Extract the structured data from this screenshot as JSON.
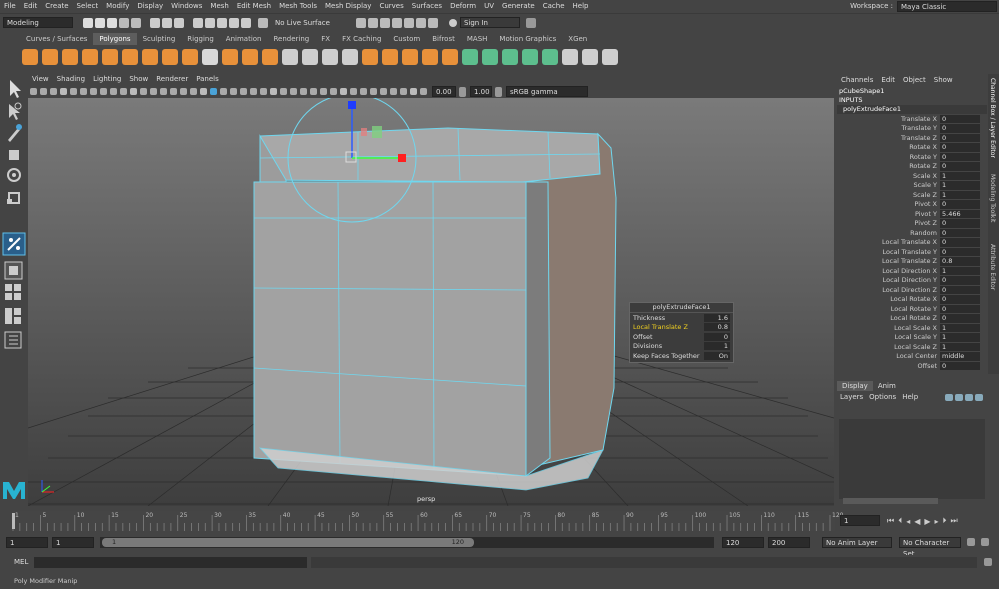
{
  "menubar": {
    "items": [
      "File",
      "Edit",
      "Create",
      "Select",
      "Modify",
      "Display",
      "Windows",
      "Mesh",
      "Edit Mesh",
      "Mesh Tools",
      "Mesh Display",
      "Curves",
      "Surfaces",
      "Deform",
      "UV",
      "Generate",
      "Cache",
      "Help"
    ],
    "workspace_label": "Workspace :",
    "workspace_value": "Maya Classic"
  },
  "statusline": {
    "mode": "Modeling",
    "live_surface": "No Live Surface",
    "sign_in": "Sign In"
  },
  "shelf": {
    "tabs": [
      "Curves / Surfaces",
      "Polygons",
      "Sculpting",
      "Rigging",
      "Animation",
      "Rendering",
      "FX",
      "FX Caching",
      "Custom",
      "Bifrost",
      "MASH",
      "Motion Graphics",
      "XGen"
    ],
    "active_tab": "Polygons",
    "icon_colors": [
      "#e8913a",
      "#e8913a",
      "#e8913a",
      "#e8913a",
      "#e8913a",
      "#e8913a",
      "#e8913a",
      "#e8913a",
      "#e8913a",
      "#d8d8d8",
      "#e8913a",
      "#e8913a",
      "#e8913a",
      "#cfcfcf",
      "#cfcfcf",
      "#cfcfcf",
      "#cfcfcf",
      "#e8913a",
      "#e8913a",
      "#e8913a",
      "#e8913a",
      "#e8913a",
      "#5dbf8e",
      "#5dbf8e",
      "#5dbf8e",
      "#5dbf8e",
      "#5dbf8e",
      "#cfcfcf",
      "#cfcfcf",
      "#cfcfcf"
    ]
  },
  "panel": {
    "menus": [
      "View",
      "Shading",
      "Lighting",
      "Show",
      "Renderer",
      "Panels"
    ],
    "field_a": "0.00",
    "field_b": "1.00",
    "color_space": "sRGB gamma",
    "camera_label": "persp"
  },
  "hud": {
    "title": "polyExtrudeFace1",
    "rows": [
      {
        "label": "Thickness",
        "value": "1.6",
        "highlight": false
      },
      {
        "label": "Local Translate Z",
        "value": "0.8",
        "highlight": true
      },
      {
        "label": "Offset",
        "value": "0",
        "highlight": false
      },
      {
        "label": "Divisions",
        "value": "1",
        "highlight": false
      },
      {
        "label": "Keep Faces Together",
        "value": "On",
        "highlight": false
      }
    ]
  },
  "channelbox": {
    "menus": [
      "Channels",
      "Edit",
      "Object",
      "Show"
    ],
    "shape": "pCubeShape1",
    "inputs": "INPUTS",
    "node": "polyExtrudeFace1",
    "attrs": [
      {
        "label": "Translate X",
        "value": "0"
      },
      {
        "label": "Translate Y",
        "value": "0"
      },
      {
        "label": "Translate Z",
        "value": "0"
      },
      {
        "label": "Rotate X",
        "value": "0"
      },
      {
        "label": "Rotate Y",
        "value": "0"
      },
      {
        "label": "Rotate Z",
        "value": "0"
      },
      {
        "label": "Scale X",
        "value": "1"
      },
      {
        "label": "Scale Y",
        "value": "1"
      },
      {
        "label": "Scale Z",
        "value": "1"
      },
      {
        "label": "Pivot X",
        "value": "0"
      },
      {
        "label": "Pivot Y",
        "value": "5.466"
      },
      {
        "label": "Pivot Z",
        "value": "0"
      },
      {
        "label": "Random",
        "value": "0"
      },
      {
        "label": "Local Translate X",
        "value": "0"
      },
      {
        "label": "Local Translate Y",
        "value": "0"
      },
      {
        "label": "Local Translate Z",
        "value": "0.8"
      },
      {
        "label": "Local Direction X",
        "value": "1"
      },
      {
        "label": "Local Direction Y",
        "value": "0"
      },
      {
        "label": "Local Direction Z",
        "value": "0"
      },
      {
        "label": "Local Rotate X",
        "value": "0"
      },
      {
        "label": "Local Rotate Y",
        "value": "0"
      },
      {
        "label": "Local Rotate Z",
        "value": "0"
      },
      {
        "label": "Local Scale X",
        "value": "1"
      },
      {
        "label": "Local Scale Y",
        "value": "1"
      },
      {
        "label": "Local Scale Z",
        "value": "1"
      },
      {
        "label": "Local Center",
        "value": "middle"
      },
      {
        "label": "Offset",
        "value": "0"
      }
    ]
  },
  "sidetabs": [
    "Channel Box / Layer Editor",
    "Modeling Toolkit",
    "Attribute Editor"
  ],
  "layers": {
    "tabs": [
      "Display",
      "Anim"
    ],
    "active_tab": "Display",
    "menus": [
      "Layers",
      "Options",
      "Help"
    ]
  },
  "timeline": {
    "ticks": [
      "1",
      "5",
      "10",
      "15",
      "20",
      "25",
      "30",
      "35",
      "40",
      "45",
      "50",
      "55",
      "60",
      "65",
      "70",
      "75",
      "80",
      "85",
      "90",
      "95",
      "100",
      "105",
      "110",
      "115",
      "120"
    ],
    "current_frame": "1"
  },
  "range": {
    "start": "1",
    "playback_start": "1",
    "slider_start": "1",
    "slider_end": "120",
    "playback_end": "120",
    "end": "200",
    "anim_layer": "No Anim Layer",
    "character_set": "No Character Set"
  },
  "mel": {
    "label": "MEL"
  },
  "help": {
    "text": "Poly Modifier Manip"
  }
}
